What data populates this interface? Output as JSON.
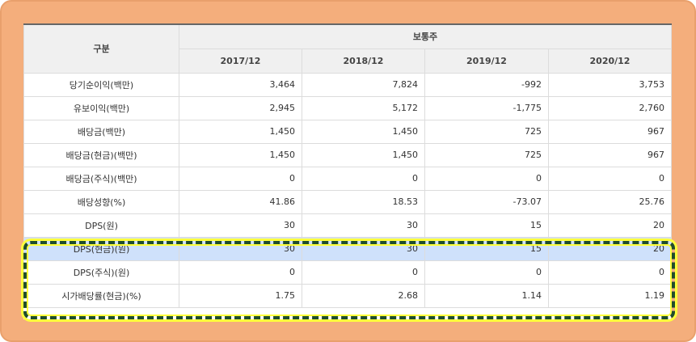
{
  "table": {
    "header_group": "구분",
    "header_span": "보통주",
    "years": [
      "2017/12",
      "2018/12",
      "2019/12",
      "2020/12"
    ],
    "rows": [
      {
        "label": "당기순이익(백만)",
        "values": [
          "3,464",
          "7,824",
          "-992",
          "3,753"
        ]
      },
      {
        "label": "유보이익(백만)",
        "values": [
          "2,945",
          "5,172",
          "-1,775",
          "2,760"
        ]
      },
      {
        "label": "배당금(백만)",
        "values": [
          "1,450",
          "1,450",
          "725",
          "967"
        ]
      },
      {
        "label": "배당금(현금)(백만)",
        "values": [
          "1,450",
          "1,450",
          "725",
          "967"
        ]
      },
      {
        "label": "배당금(주식)(백만)",
        "values": [
          "0",
          "0",
          "0",
          "0"
        ]
      },
      {
        "label": "배당성향(%)",
        "values": [
          "41.86",
          "18.53",
          "-73.07",
          "25.76"
        ]
      },
      {
        "label": "DPS(원)",
        "values": [
          "30",
          "30",
          "15",
          "20"
        ]
      },
      {
        "label": "DPS(현금)(원)",
        "values": [
          "30",
          "30",
          "15",
          "20"
        ]
      },
      {
        "label": "DPS(주식)(원)",
        "values": [
          "0",
          "0",
          "0",
          "0"
        ]
      },
      {
        "label": "시가배당률(현금)(%)",
        "values": [
          "1.75",
          "2.68",
          "1.14",
          "1.19"
        ]
      }
    ]
  },
  "colors": {
    "frame": "#f4ae7c",
    "highlight_border": "#1f4d2c",
    "highlight_glow": "#ffff3c",
    "selected_row": "#cfe1fb"
  }
}
